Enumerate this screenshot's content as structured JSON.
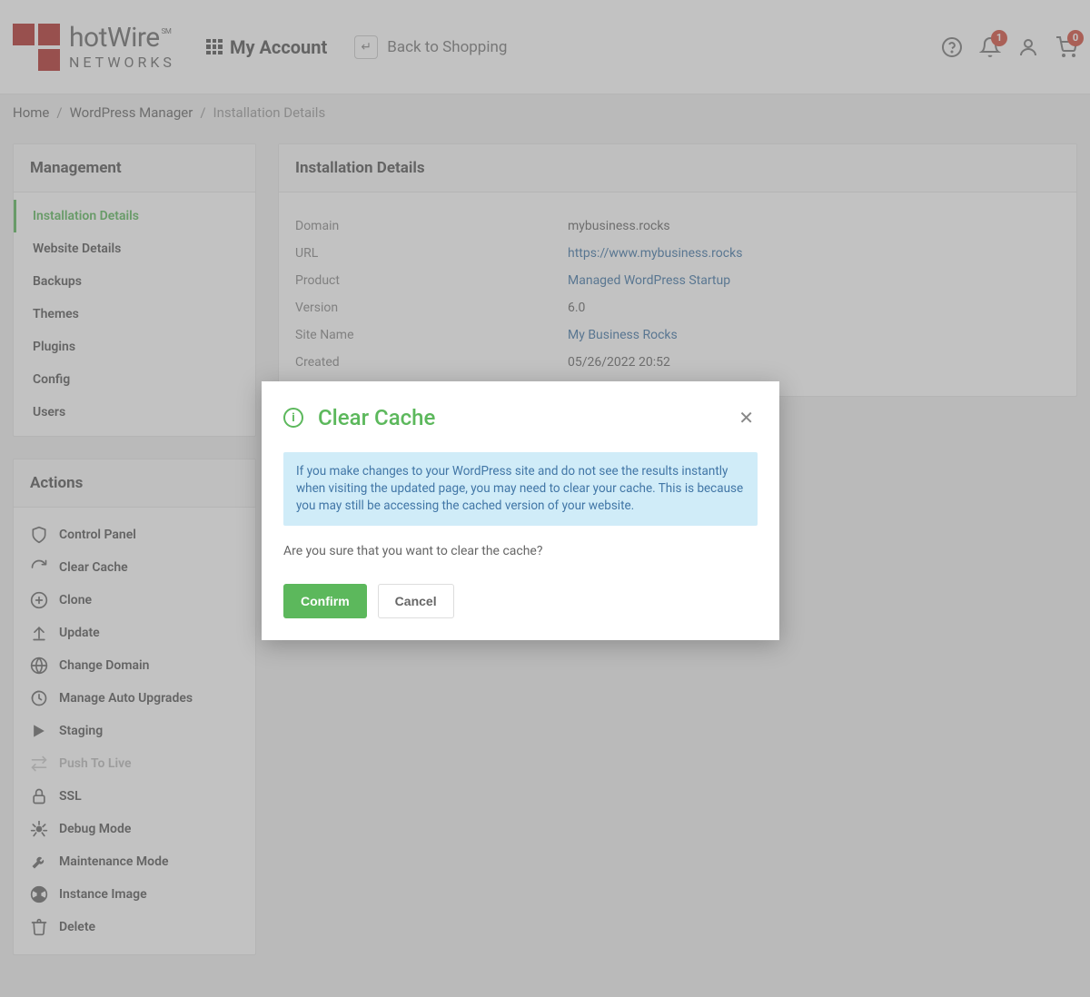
{
  "header": {
    "logo_top": "hotWire",
    "logo_sm": "SM",
    "logo_bottom": "NETWORKS",
    "my_account": "My Account",
    "back_to_shopping": "Back to Shopping",
    "notif_badge": "1",
    "cart_badge": "0"
  },
  "breadcrumb": {
    "home": "Home",
    "wp_manager": "WordPress Manager",
    "current": "Installation Details"
  },
  "management": {
    "title": "Management",
    "items": [
      "Installation Details",
      "Website Details",
      "Backups",
      "Themes",
      "Plugins",
      "Config",
      "Users"
    ]
  },
  "actions": {
    "title": "Actions",
    "items": [
      {
        "label": "Control Panel",
        "icon": "shield",
        "disabled": false
      },
      {
        "label": "Clear Cache",
        "icon": "refresh",
        "disabled": false
      },
      {
        "label": "Clone",
        "icon": "plus-circle",
        "disabled": false
      },
      {
        "label": "Update",
        "icon": "upload",
        "disabled": false
      },
      {
        "label": "Change Domain",
        "icon": "globe",
        "disabled": false
      },
      {
        "label": "Manage Auto Upgrades",
        "icon": "history",
        "disabled": false
      },
      {
        "label": "Staging",
        "icon": "arrow-right",
        "disabled": false
      },
      {
        "label": "Push To Live",
        "icon": "swap",
        "disabled": true
      },
      {
        "label": "SSL",
        "icon": "lock",
        "disabled": false
      },
      {
        "label": "Debug Mode",
        "icon": "bug",
        "disabled": false
      },
      {
        "label": "Maintenance Mode",
        "icon": "wrench",
        "disabled": false
      },
      {
        "label": "Instance Image",
        "icon": "radiation",
        "disabled": false
      },
      {
        "label": "Delete",
        "icon": "trash",
        "disabled": false
      }
    ]
  },
  "details": {
    "title": "Installation Details",
    "rows": [
      {
        "label": "Domain",
        "value": "mybusiness.rocks",
        "link": false
      },
      {
        "label": "URL",
        "value": "https://www.mybusiness.rocks",
        "link": true
      },
      {
        "label": "Product",
        "value": "Managed WordPress Startup",
        "link": true
      },
      {
        "label": "Version",
        "value": "6.0",
        "link": false
      },
      {
        "label": "Site Name",
        "value": "My Business Rocks",
        "link": true
      },
      {
        "label": "Created",
        "value": "05/26/2022 20:52",
        "link": false
      }
    ]
  },
  "modal": {
    "title": "Clear Cache",
    "info": "If you make changes to your WordPress site and do not see the results instantly when visiting the updated page, you may need to clear your cache. This is because you may still be accessing the cached version of your website.",
    "question": "Are you sure that you want to clear the cache?",
    "confirm": "Confirm",
    "cancel": "Cancel"
  }
}
